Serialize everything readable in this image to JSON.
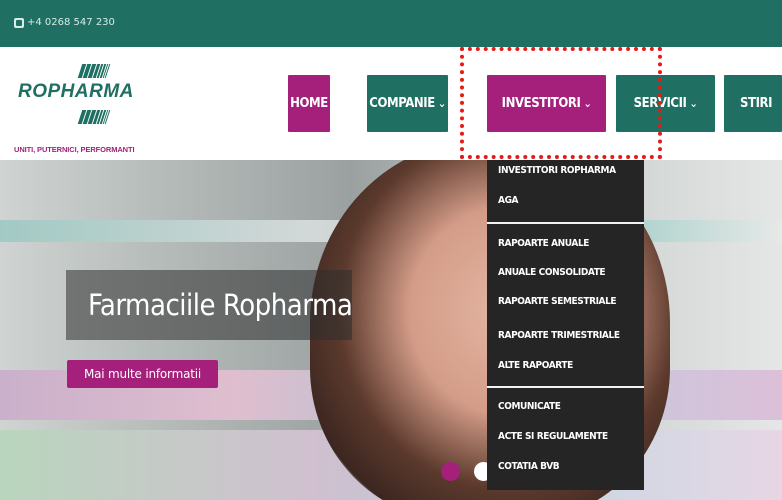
{
  "topbar": {
    "phone": "+4 0268 547 230",
    "icon": "phone-icon",
    "bg": "#1f6f62"
  },
  "logo": {
    "name": "ROPHARMA",
    "tagline": "UNITI, PUTERNICI, PERFORMANTI"
  },
  "nav": {
    "home": "HOME",
    "companie": "COMPANIE",
    "investitori": "INVESTITORI",
    "servicii": "SERVICII",
    "stiri": "STIRI",
    "chevron": "⌄"
  },
  "dropdown": {
    "group1": [
      "INVESTITORI ROPHARMA",
      "AGA"
    ],
    "group2": [
      "RAPOARTE ANUALE",
      "ANUALE CONSOLIDATE",
      "RAPOARTE SEMESTRIALE",
      "RAPOARTE TRIMESTRIALE",
      "ALTE RAPOARTE"
    ],
    "group3": [
      "COMUNICATE",
      "ACTE SI REGULAMENTE",
      "COTATIA BVB"
    ]
  },
  "hero": {
    "title": "Farmaciile Ropharma",
    "button": "Mai multe informatii"
  },
  "colors": {
    "accent": "#a5207b",
    "brand": "#1f6f62",
    "dropdown_bg": "#252525",
    "highlight": "#e41b17"
  }
}
